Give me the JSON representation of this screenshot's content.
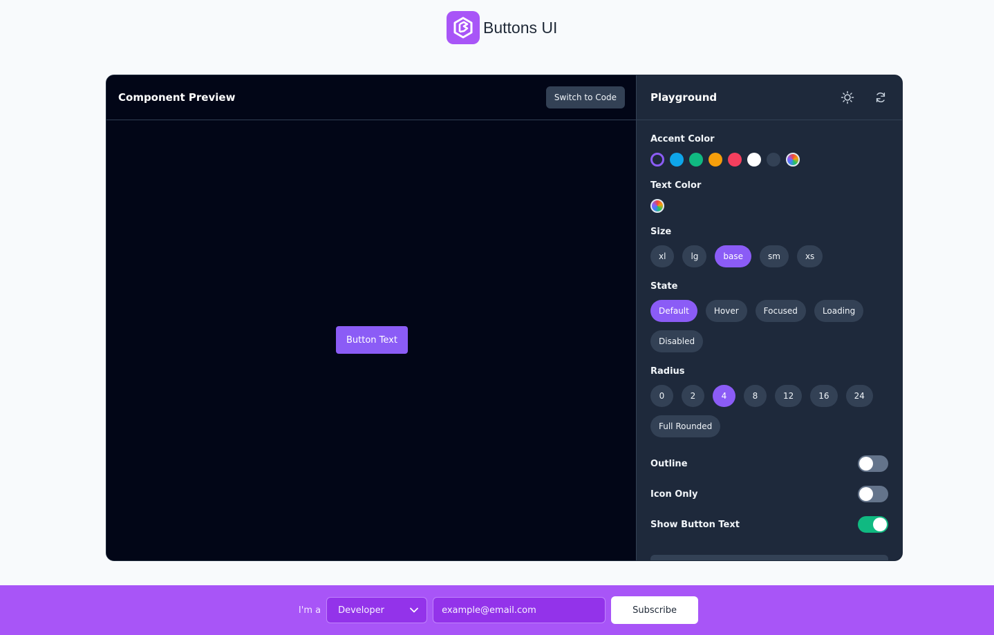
{
  "brand": {
    "name": "Buttons UI",
    "logo_icon": "buttons-ui-logo-icon",
    "logo_color": "#a855f7"
  },
  "preview": {
    "title": "Component Preview",
    "switch_label": "Switch to Code",
    "demo_button": {
      "label": "Button Text",
      "color": "#8b5cf6",
      "text_color": "#ffffff",
      "radius": "4"
    }
  },
  "playground": {
    "title": "Playground",
    "icons": [
      "sun-icon",
      "refresh-icon"
    ],
    "accent": {
      "label": "Accent Color",
      "swatches": [
        {
          "name": "purple",
          "color": "#8b5cf6",
          "selected": true
        },
        {
          "name": "sky",
          "color": "#0ea5e9",
          "selected": false
        },
        {
          "name": "green",
          "color": "#10b981",
          "selected": false
        },
        {
          "name": "amber",
          "color": "#f59e0b",
          "selected": false
        },
        {
          "name": "rose",
          "color": "#f43f5e",
          "selected": false
        },
        {
          "name": "white",
          "color": "#ffffff",
          "selected": false
        },
        {
          "name": "slate",
          "color": "#334155",
          "selected": false
        },
        {
          "name": "custom",
          "color": "rainbow",
          "selected": false
        }
      ]
    },
    "text_color": {
      "label": "Text Color",
      "swatches": [
        {
          "name": "custom",
          "color": "rainbow"
        }
      ]
    },
    "size": {
      "label": "Size",
      "options": [
        "xl",
        "lg",
        "base",
        "sm",
        "xs"
      ],
      "selected": "base"
    },
    "state": {
      "label": "State",
      "options": [
        "Default",
        "Hover",
        "Focused",
        "Loading",
        "Disabled"
      ],
      "selected": "Default"
    },
    "radius": {
      "label": "Radius",
      "options": [
        "0",
        "2",
        "4",
        "8",
        "12",
        "16",
        "24",
        "Full Rounded"
      ],
      "selected": "4"
    },
    "toggles": [
      {
        "label": "Outline",
        "on": false
      },
      {
        "label": "Icon Only",
        "on": false
      },
      {
        "label": "Show Button Text",
        "on": true
      }
    ]
  },
  "footer": {
    "prefix": "I'm a",
    "role": "Developer",
    "email_placeholder": "example@email.com",
    "subscribe_label": "Subscribe",
    "background": "#a855f7"
  }
}
